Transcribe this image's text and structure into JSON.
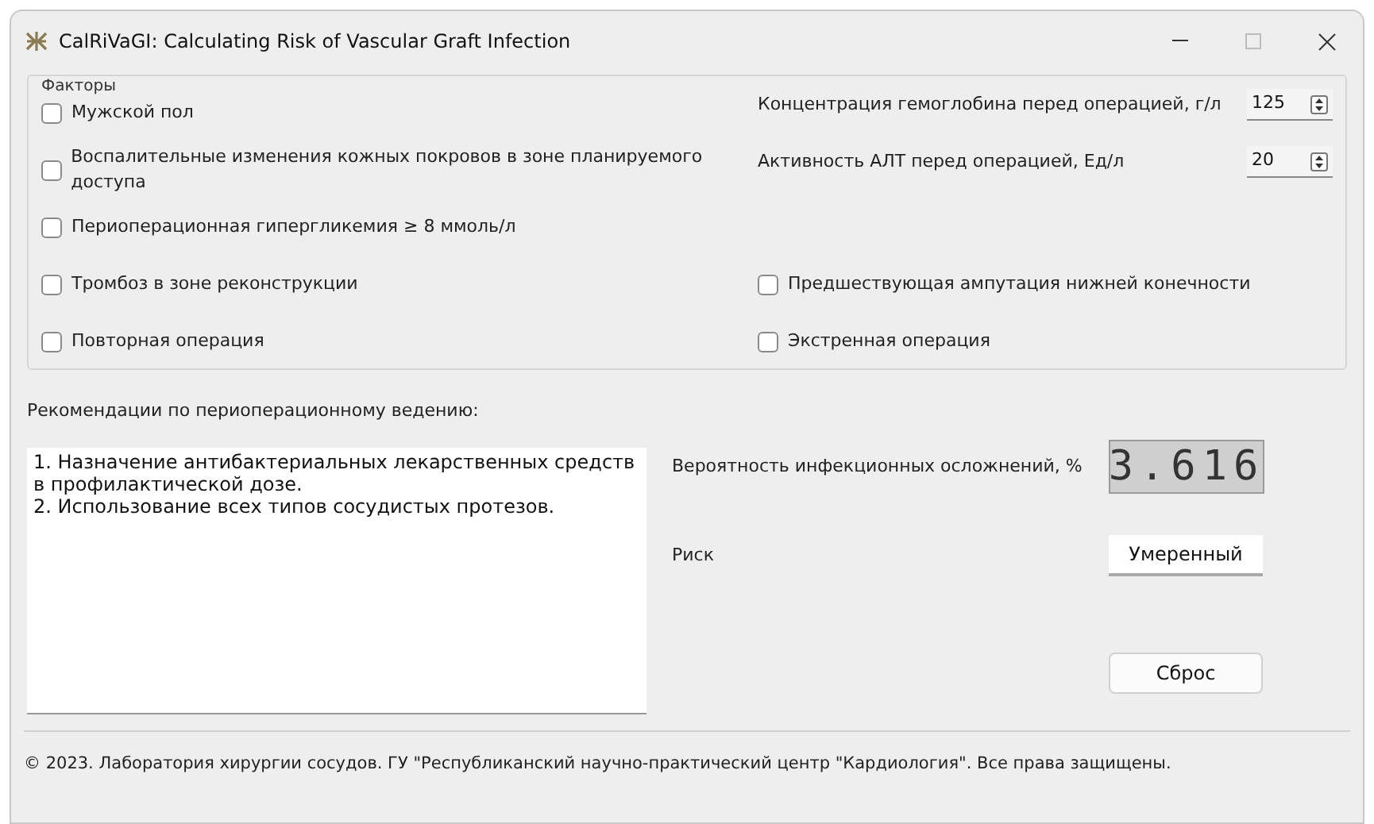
{
  "window": {
    "title": "CalRiVaGI: Calculating Risk of Vascular Graft Infection"
  },
  "factors": {
    "title": "Факторы",
    "left": [
      {
        "label": "Мужской пол",
        "checked": false
      },
      {
        "label": "Воспалительные изменения кожных покровов в зоне планируемого доступа",
        "checked": false
      },
      {
        "label": "Периоперационная гипергликемия ≥ 8 ммоль/л",
        "checked": false
      },
      {
        "label": "Тромбоз в зоне реконструкции",
        "checked": false
      },
      {
        "label": "Повторная операция",
        "checked": false
      }
    ],
    "measurements": [
      {
        "label": "Концентрация гемоглобина перед операцией, г/л",
        "value": "125"
      },
      {
        "label": "Активность АЛТ перед операцией, Ед/л",
        "value": "20"
      }
    ],
    "right": [
      {
        "label": "Предшествующая ампутация нижней конечности",
        "checked": false
      },
      {
        "label": "Экстренная операция",
        "checked": false
      }
    ]
  },
  "recommendations": {
    "label": "Рекомендации по периоперационному ведению:",
    "text": "1. Назначение антибактериальных лекарственных средств в профилактической дозе.\n2. Использование всех типов сосудистых протезов."
  },
  "probability": {
    "label": "Вероятность инфекционных осложнений, %",
    "value": "3.616"
  },
  "risk": {
    "label": "Риск",
    "value": "Умеренный"
  },
  "reset_button": "Сброс",
  "footer": "© 2023. Лаборатория хирургии сосудов. ГУ \"Республиканский научно-практический центр \"Кардиология\". Все права защищены."
}
